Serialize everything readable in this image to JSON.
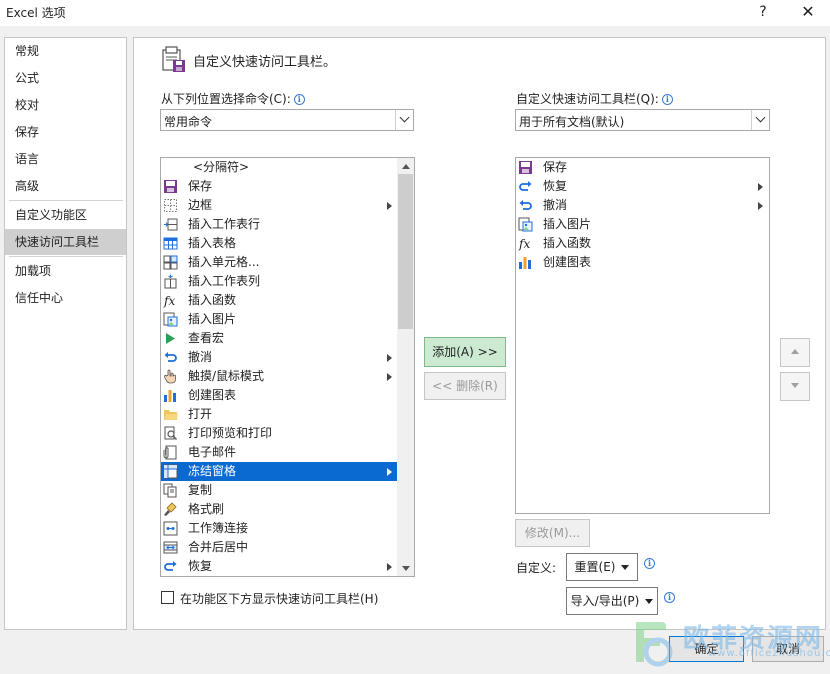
{
  "window": {
    "title": "Excel 选项",
    "help_glyph": "?",
    "close_glyph": "✕"
  },
  "sidebar": {
    "items": [
      {
        "label": "常规"
      },
      {
        "label": "公式"
      },
      {
        "label": "校对"
      },
      {
        "label": "保存"
      },
      {
        "label": "语言"
      },
      {
        "label": "高级"
      },
      {
        "label": "自定义功能区"
      },
      {
        "label": "快速访问工具栏",
        "active": true
      },
      {
        "label": "加载项"
      },
      {
        "label": "信任中心"
      }
    ]
  },
  "header": {
    "text": "自定义快速访问工具栏。"
  },
  "left_panel": {
    "label": "从下列位置选择命令(C):",
    "combo_value": "常用命令",
    "items": [
      {
        "label": "<分隔符>",
        "icon": "separator",
        "submenu": false
      },
      {
        "label": "保存",
        "icon": "save-icon",
        "submenu": false
      },
      {
        "label": "边框",
        "icon": "border-icon",
        "submenu": true
      },
      {
        "label": "插入工作表行",
        "icon": "insert-row-icon",
        "submenu": false
      },
      {
        "label": "插入表格",
        "icon": "insert-table-icon",
        "submenu": false
      },
      {
        "label": "插入单元格...",
        "icon": "insert-cells-icon",
        "submenu": false
      },
      {
        "label": "插入工作表列",
        "icon": "insert-column-icon",
        "submenu": false
      },
      {
        "label": "插入函数",
        "icon": "function-icon",
        "submenu": false
      },
      {
        "label": "插入图片",
        "icon": "picture-icon",
        "submenu": false
      },
      {
        "label": "查看宏",
        "icon": "macro-icon",
        "submenu": false
      },
      {
        "label": "撤消",
        "icon": "undo-icon",
        "submenu": true
      },
      {
        "label": "触摸/鼠标模式",
        "icon": "touch-icon",
        "submenu": true
      },
      {
        "label": "创建图表",
        "icon": "chart-icon",
        "submenu": false
      },
      {
        "label": "打开",
        "icon": "open-folder-icon",
        "submenu": false
      },
      {
        "label": "打印预览和打印",
        "icon": "print-preview-icon",
        "submenu": false
      },
      {
        "label": "电子邮件",
        "icon": "email-icon",
        "submenu": false
      },
      {
        "label": "冻结窗格",
        "icon": "freeze-panes-icon",
        "submenu": true,
        "selected": true
      },
      {
        "label": "复制",
        "icon": "copy-icon",
        "submenu": false
      },
      {
        "label": "格式刷",
        "icon": "format-painter-icon",
        "submenu": false
      },
      {
        "label": "工作簿连接",
        "icon": "connections-icon",
        "submenu": false
      },
      {
        "label": "合并后居中",
        "icon": "merge-center-icon",
        "submenu": false
      },
      {
        "label": "恢复",
        "icon": "redo-icon",
        "submenu": true
      }
    ]
  },
  "right_panel": {
    "label": "自定义快速访问工具栏(Q):",
    "combo_value": "用于所有文档(默认)",
    "items": [
      {
        "label": "保存",
        "icon": "save-icon",
        "submenu": false
      },
      {
        "label": "恢复",
        "icon": "redo-icon",
        "submenu": true
      },
      {
        "label": "撤消",
        "icon": "undo-icon",
        "submenu": true
      },
      {
        "label": "插入图片",
        "icon": "picture-icon",
        "submenu": false
      },
      {
        "label": "插入函数",
        "icon": "function-icon",
        "submenu": false
      },
      {
        "label": "创建图表",
        "icon": "chart-icon",
        "submenu": false
      }
    ]
  },
  "buttons": {
    "add": "添加(A) >>",
    "remove": "<< 删除(R)",
    "modify": "修改(M)...",
    "customize_label": "自定义:",
    "reset": "重置(E)",
    "import_export": "导入/导出(P)",
    "ok": "确定",
    "cancel": "取消"
  },
  "checkbox": {
    "label": "在功能区下方显示快速访问工具栏(H)",
    "checked": false
  },
  "watermark": {
    "text": "欧菲资源网",
    "url": "www.officezhushou.com"
  },
  "colors": {
    "selection": "#0b6ad2",
    "accent_purple": "#7a3b8f",
    "add_button_bg": "#ccead2"
  }
}
